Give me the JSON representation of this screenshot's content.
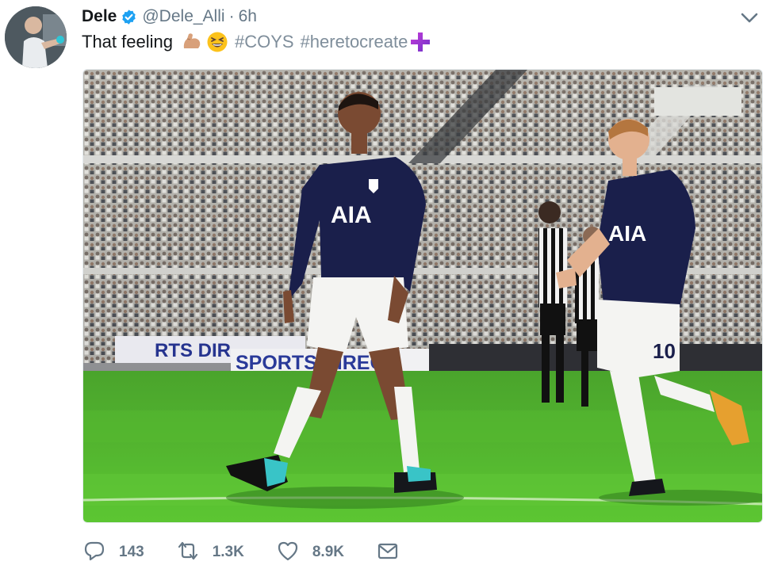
{
  "author": {
    "display_name": "Dele",
    "handle": "@Dele_Alli",
    "separator": "·",
    "timestamp": "6h"
  },
  "tweet": {
    "text": "That feeling",
    "hashtags": [
      "#COYS",
      "#heretocreate"
    ]
  },
  "actions": {
    "reply_count": "143",
    "retweet_count": "1.3K",
    "like_count": "8.9K"
  },
  "colors": {
    "verified": "#1da1f2",
    "muted": "#657786",
    "hashtag": "#7f8e9b",
    "kit_navy": "#1a1f4b",
    "pitch": "#3fae2a"
  },
  "icons": [
    "verified-icon",
    "chevron-down-icon",
    "flexed-biceps-emoji",
    "grinning-squinting-face-emoji",
    "plus-emoji",
    "reply-icon",
    "retweet-icon",
    "heart-icon",
    "mail-icon"
  ],
  "media": {
    "shirt_sponsor_left": "AIA",
    "shirt_sponsor_right": "AIA",
    "shirt_number": "10",
    "board_1": "RTS DIR",
    "board_2": "SPORTS DIREC"
  }
}
